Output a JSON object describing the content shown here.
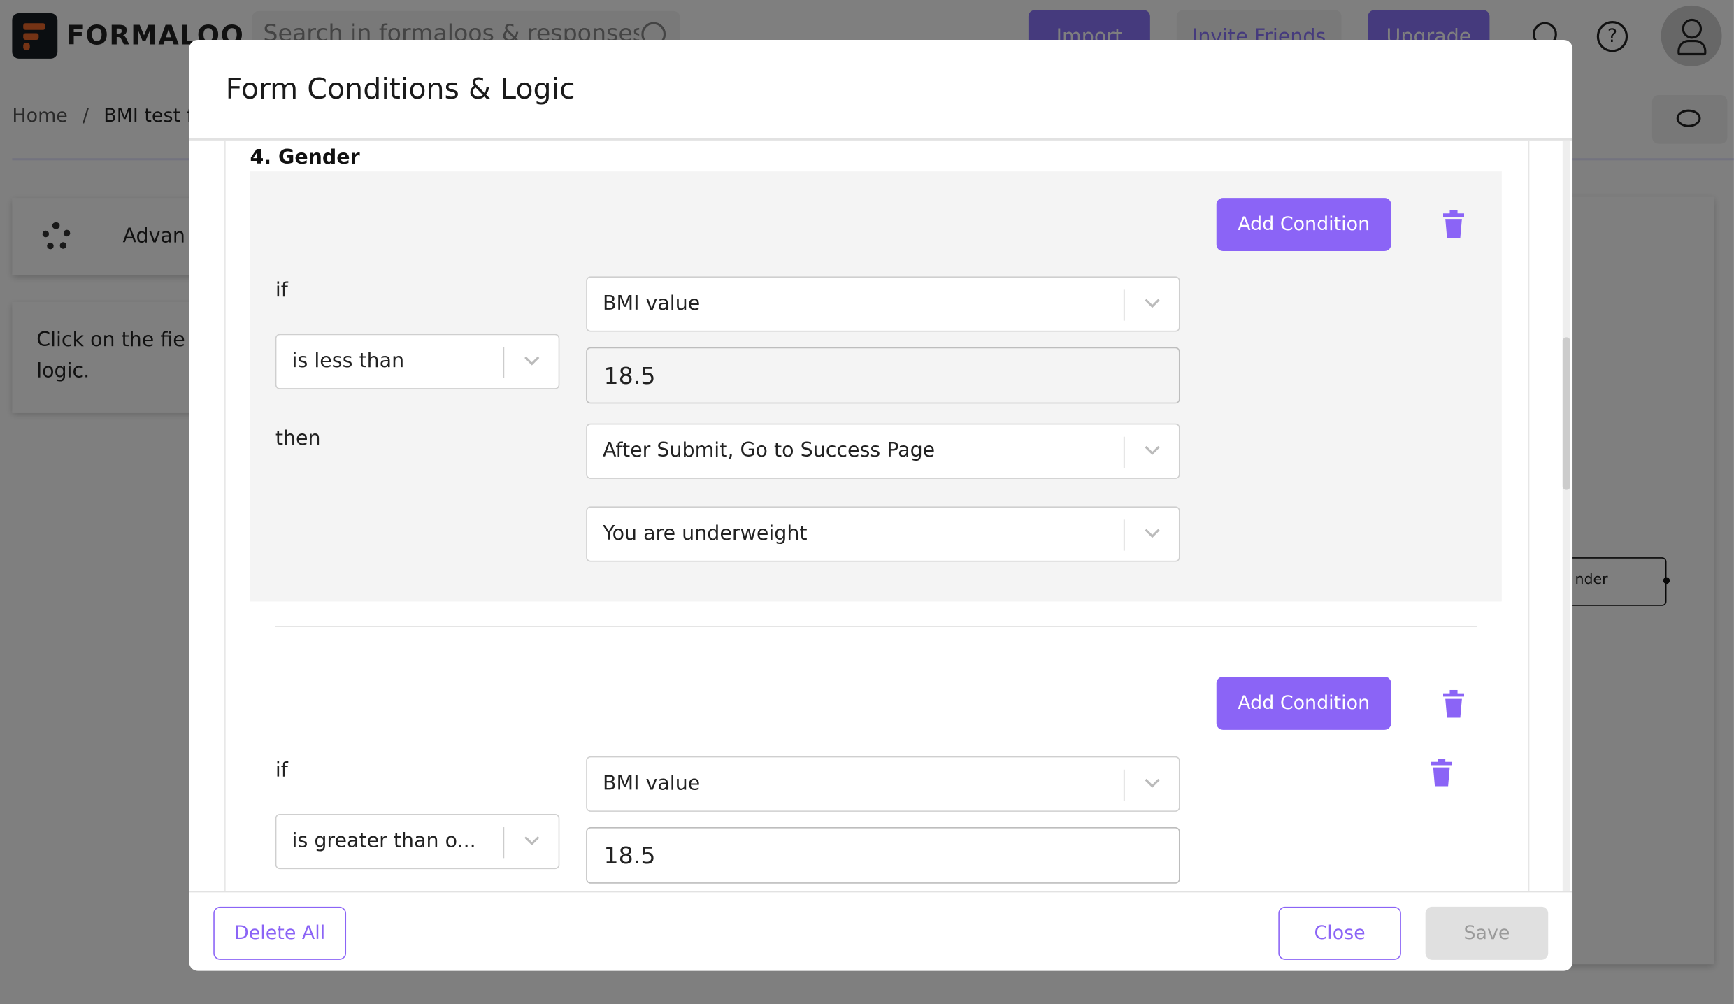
{
  "app": {
    "logo_text": "FORMALOO",
    "search_placeholder": "Search in formaloos & responses",
    "import_label": "Import",
    "invite_label": "Invite Friends",
    "upgrade_label": "Upgrade",
    "breadcrumb": [
      "Home",
      "/",
      "BMI test f"
    ],
    "left_panel": {
      "advanced_label": "Advan",
      "hint_line1": "Click on the fie",
      "hint_line2": "logic."
    },
    "canvas_node_label": "nder"
  },
  "modal": {
    "title": "Form Conditions & Logic",
    "question_title": "4. Gender",
    "rules": [
      {
        "add_condition_label": "Add Condition",
        "if_label": "if",
        "field": "BMI value",
        "operator": "is less than",
        "value": "18.5",
        "then_label": "then",
        "action": "After Submit, Go to Success Page",
        "target": "You are underweight"
      },
      {
        "add_condition_label": "Add Condition",
        "if_label": "if",
        "field": "BMI value",
        "operator": "is greater than o...",
        "value": "18.5"
      }
    ],
    "footer": {
      "delete_all_label": "Delete All",
      "close_label": "Close",
      "save_label": "Save"
    }
  },
  "colors": {
    "accent": "#8b64f6",
    "disabled": "#e0e0e0",
    "block_bg": "#f4f4f4"
  }
}
